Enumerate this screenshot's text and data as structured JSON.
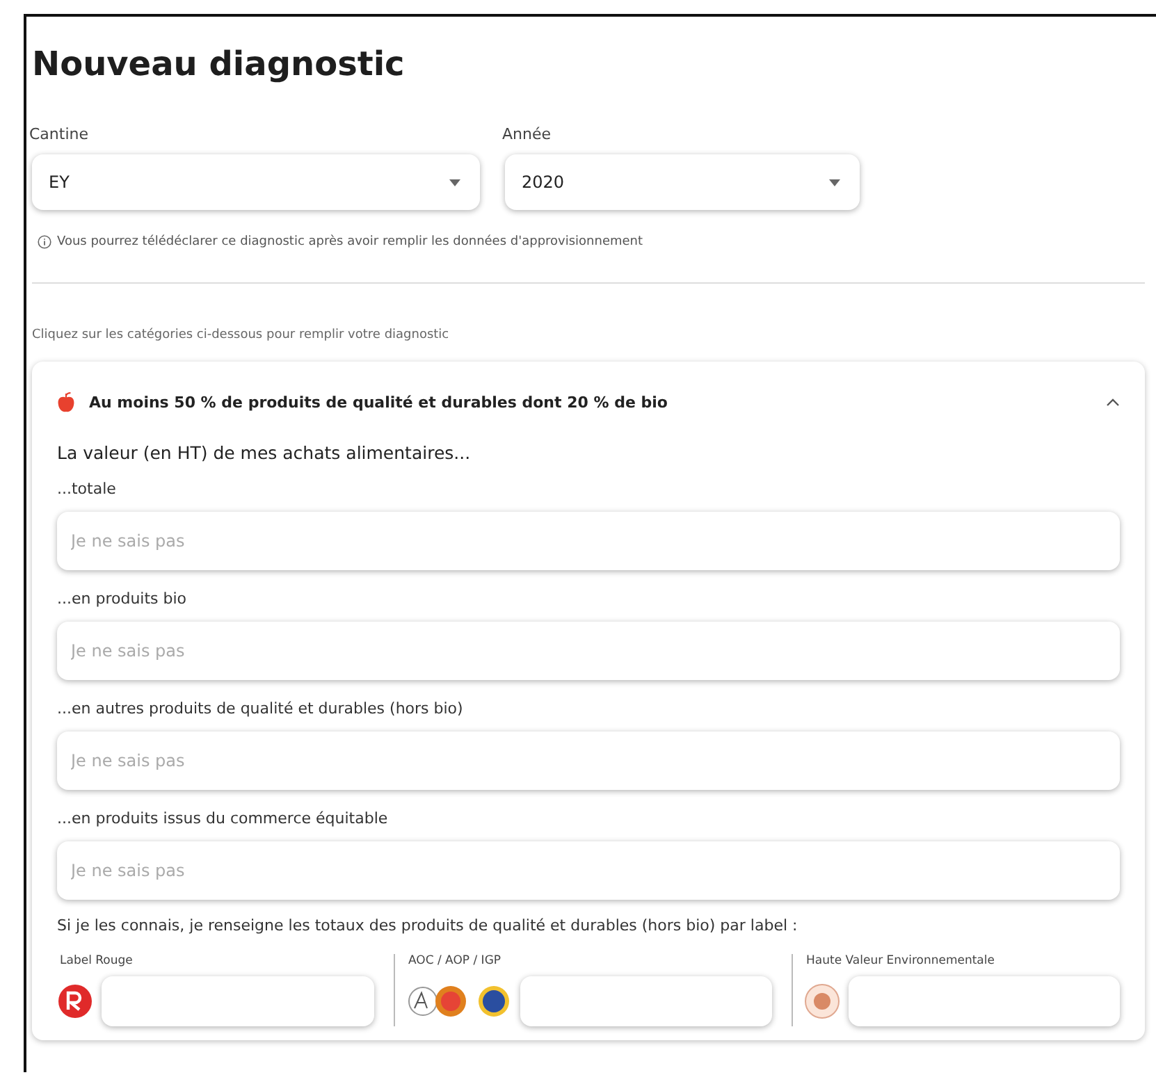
{
  "title": "Nouveau diagnostic",
  "selects": [
    {
      "label": "Cantine",
      "value": "EY"
    },
    {
      "label": "Année",
      "value": "2020"
    }
  ],
  "info": "Vous pourrez télédéclarer ce diagnostic après avoir remplir les données d'approvisionnement",
  "instruction": "Cliquez sur les catégories ci-dessous pour remplir votre diagnostic",
  "section": {
    "title": "Au moins 50 % de produits de qualité et durables dont 20 % de bio",
    "expanded": true,
    "intro": "La valeur (en HT) de mes achats alimentaires...",
    "fields": [
      {
        "label": "...totale",
        "placeholder": "Je ne sais pas"
      },
      {
        "label": "...en produits bio",
        "placeholder": "Je ne sais pas"
      },
      {
        "label": "...en autres produits de qualité et durables (hors bio)",
        "placeholder": "Je ne sais pas"
      },
      {
        "label": "...en produits issus du commerce équitable",
        "placeholder": "Je ne sais pas"
      }
    ],
    "label_intro": "Si je les connais, je renseigne les totaux des produits de qualité et durables (hors bio) par label :",
    "labels": [
      {
        "name": "Label Rouge",
        "kind": "rouge"
      },
      {
        "name": "AOC / AOP / IGP",
        "kind": "aoc"
      },
      {
        "name": "Haute Valeur Environnementale",
        "kind": "hve"
      }
    ]
  }
}
